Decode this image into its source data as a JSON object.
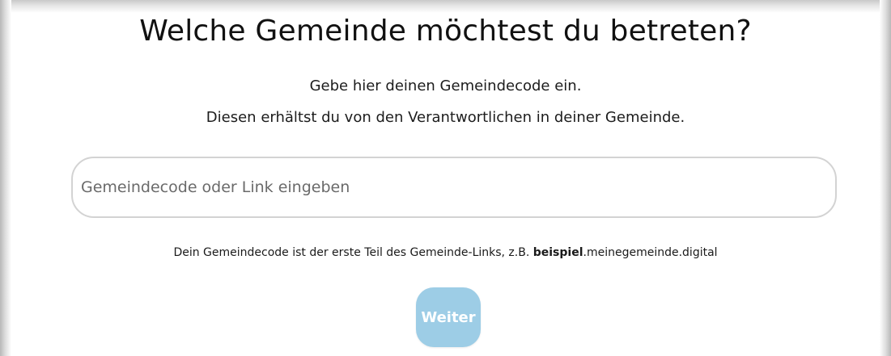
{
  "heading": {
    "title": "Welche Gemeinde möchtest du betreten?"
  },
  "intro": {
    "line1": "Gebe hier deinen Gemeindecode ein.",
    "line2": "Diesen erhältst du von den Verantwortlichen in deiner Gemeinde."
  },
  "code_field": {
    "value": "",
    "placeholder": "Gemeindecode oder Link eingeben"
  },
  "hint": {
    "prefix": "Dein Gemeindecode ist der erste Teil des Gemeinde-Links, z.B. ",
    "example_code": "beispiel",
    "example_domain": ".meinegemeinde.digital"
  },
  "actions": {
    "next_label": "Weiter"
  },
  "colors": {
    "button_background": "#9dcde6",
    "button_text": "#ffffff",
    "input_border": "#d3d3d3"
  }
}
